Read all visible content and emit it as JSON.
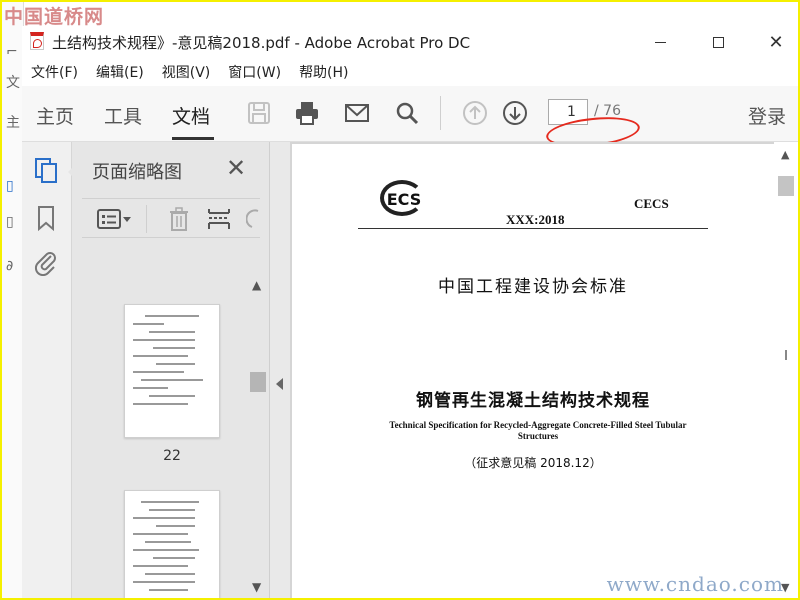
{
  "watermarks": {
    "top": "中国道桥网",
    "bottom": "www.cndao.com"
  },
  "background_window": {
    "chars": [
      "文",
      "主",
      "文"
    ]
  },
  "window": {
    "title": "土结构技术规程》-意见稿2018.pdf - Adobe Acrobat Pro DC",
    "close_glyph": "✕"
  },
  "menu": {
    "items": [
      "文件(F)",
      "编辑(E)",
      "视图(V)",
      "窗口(W)",
      "帮助(H)"
    ]
  },
  "toolbar": {
    "tabs": {
      "home": "主页",
      "tools": "工具",
      "document": "文档"
    },
    "page_current": "1",
    "page_total": "/ 76",
    "login": "登录"
  },
  "thumbnail_panel": {
    "title": "页面缩略图",
    "close_glyph": "✕",
    "thumbnails": [
      {
        "label": "22"
      },
      {
        "label": ""
      }
    ]
  },
  "document": {
    "logo_text": "ECS",
    "publisher": "CECS",
    "standard_number": "XXX:2018",
    "association": "中国工程建设协会标准",
    "title_cn": "钢管再生混凝土结构技术规程",
    "title_en": "Technical Specification for Recycled-Aggregate Concrete-Filled Steel Tubular Structures",
    "draft_note": "（征求意见稿 2018.12）"
  },
  "colors": {
    "frame": "#f5f000",
    "annotation": "#e52a1e",
    "toolbar_bg": "#f7f7f7",
    "panel_bg": "#e6e6e6",
    "icon_active": "#2a6fc9"
  }
}
